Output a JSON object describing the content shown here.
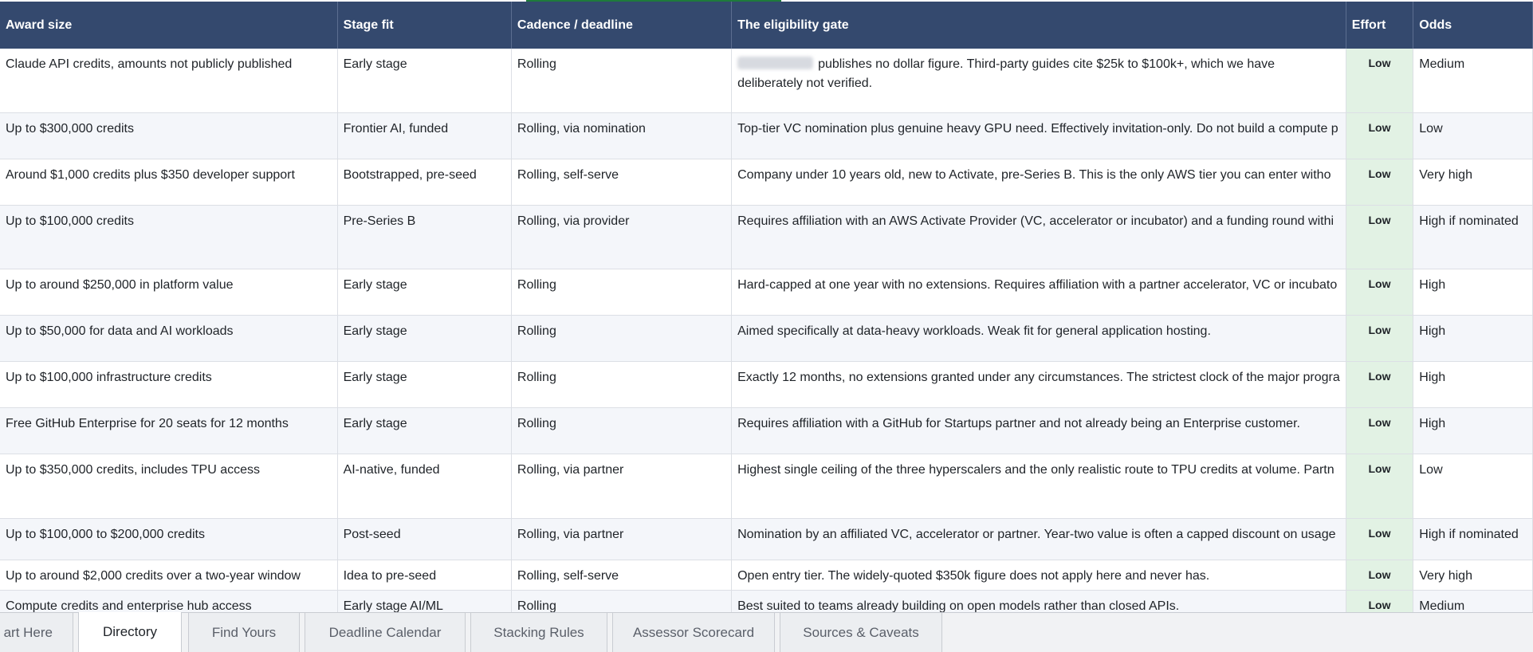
{
  "table": {
    "headers": [
      "Award size",
      "Stage fit",
      "Cadence / deadline",
      "The eligibility gate",
      "Effort",
      "Odds"
    ],
    "rows": [
      {
        "award": "Claude API credits, amounts not publicly published",
        "stage": "Early stage",
        "cadence": "Rolling",
        "gate": "publishes no dollar figure. Third-party guides cite $25k to $100k+, which we have deliberately not verified.",
        "effort": "Low",
        "odds": "Medium"
      },
      {
        "award": "Up to $300,000 credits",
        "stage": "Frontier AI, funded",
        "cadence": "Rolling, via nomination",
        "gate": "Top-tier VC nomination plus genuine heavy GPU need. Effectively invitation-only. Do not build a compute p",
        "effort": "Low",
        "odds": "Low"
      },
      {
        "award": "Around $1,000 credits plus $350 developer support",
        "stage": "Bootstrapped, pre-seed",
        "cadence": "Rolling, self-serve",
        "gate": "Company under 10 years old, new to Activate, pre-Series B. This is the only AWS tier you can enter witho",
        "effort": "Low",
        "odds": "Very high"
      },
      {
        "award": "Up to $100,000 credits",
        "stage": "Pre-Series B",
        "cadence": "Rolling, via provider",
        "gate": "Requires affiliation with an AWS Activate Provider (VC, accelerator or incubator) and a funding round withi",
        "effort": "Low",
        "odds": "High if nominated"
      },
      {
        "award": "Up to around $250,000 in platform value",
        "stage": "Early stage",
        "cadence": "Rolling",
        "gate": "Hard-capped at one year with no extensions. Requires affiliation with a partner accelerator, VC or incubato",
        "effort": "Low",
        "odds": "High"
      },
      {
        "award": "Up to $50,000 for data and AI workloads",
        "stage": "Early stage",
        "cadence": "Rolling",
        "gate": "Aimed specifically at data-heavy workloads. Weak fit for general application hosting.",
        "effort": "Low",
        "odds": "High"
      },
      {
        "award": "Up to $100,000 infrastructure credits",
        "stage": "Early stage",
        "cadence": "Rolling",
        "gate": "Exactly 12 months, no extensions granted under any circumstances. The strictest clock of the major progra",
        "effort": "Low",
        "odds": "High"
      },
      {
        "award": "Free GitHub Enterprise for 20 seats for 12 months",
        "stage": "Early stage",
        "cadence": "Rolling",
        "gate": "Requires affiliation with a GitHub for Startups partner and not already being an Enterprise customer.",
        "effort": "Low",
        "odds": "High"
      },
      {
        "award": "Up to $350,000 credits, includes TPU access",
        "stage": "AI-native, funded",
        "cadence": "Rolling, via partner",
        "gate": "Highest single ceiling of the three hyperscalers and the only realistic route to TPU credits at volume. Partn",
        "effort": "Low",
        "odds": "Low"
      },
      {
        "award": "Up to $100,000 to $200,000 credits",
        "stage": "Post-seed",
        "cadence": "Rolling, via partner",
        "gate": "Nomination by an affiliated VC, accelerator or partner. Year-two value is often a capped discount on usage",
        "effort": "Low",
        "odds": "High if nominated"
      },
      {
        "award": "Up to around $2,000 credits over a two-year window",
        "stage": "Idea to pre-seed",
        "cadence": "Rolling, self-serve",
        "gate": "Open entry tier. The widely-quoted $350k figure does not apply here and never has.",
        "effort": "Low",
        "odds": "Very high"
      },
      {
        "award": "Compute credits and enterprise hub access",
        "stage": "Early stage AI/ML",
        "cadence": "Rolling",
        "gate": "Best suited to teams already building on open models rather than closed APIs.",
        "effort": "Low",
        "odds": "Medium"
      }
    ]
  },
  "sheet_tabs": [
    "art Here",
    "Directory",
    "Find Yours",
    "Deadline Calendar",
    "Stacking Rules",
    "Assessor Scorecard",
    "Sources & Caveats"
  ],
  "active_tab": "Directory",
  "colors": {
    "header_bg": "#34496e",
    "effort_bg": "#e2f2e4",
    "alt_row_bg": "#f4f6fa"
  }
}
